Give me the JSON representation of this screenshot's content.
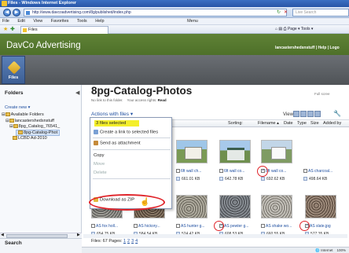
{
  "window": {
    "title": "Files - Windows Internet Explorer"
  },
  "browser": {
    "url": "http://www.davcoadvertising.com/8g/published/index.php",
    "search_placeholder": "Live Search",
    "menu": [
      "File",
      "Edit",
      "View",
      "Favorites",
      "Tools",
      "Help",
      "Menu"
    ],
    "tab_title": "Files",
    "toolset_label": "Page ▾  Tools ▾"
  },
  "app": {
    "brand": "DavCo Advertising",
    "user_links": "lancastershedsnstuff | Help | Logo",
    "files_button": "Files"
  },
  "sidebar": {
    "heading": "Folders",
    "create_new": "Create new ▾",
    "tree": [
      "Available Folders",
      "lancastershedsnstuff",
      "8pg_Catalog_76541_",
      "8pg-Catalog-Phot",
      "LCBD Ad-2010"
    ],
    "search_label": "Search"
  },
  "main": {
    "title": "8pg-Catalog-Photos",
    "no_link": "No link to this folder.",
    "access_label": "Your access rights:",
    "access_value": "Read",
    "full_screen": "Full scree",
    "actions_label": "Actions with files ▾",
    "view_label": "View:",
    "columns": {
      "sorting": "Sorting:",
      "filename": "Filename ▴",
      "date": "Date",
      "type": "Type",
      "size": "Size",
      "added_by": "Added by"
    },
    "files_footer_label": "Files: 67  Pages:",
    "pages": [
      "1",
      "2",
      "3",
      "4"
    ]
  },
  "dropdown": {
    "selected_count": "3 files selected",
    "items": [
      {
        "label": "Create a link to selected files",
        "enabled": true
      },
      {
        "label": "Send as attachment",
        "enabled": true
      },
      {
        "label": "Copy",
        "enabled": true
      },
      {
        "label": "Move",
        "enabled": false
      },
      {
        "label": "Delete",
        "enabled": false
      },
      {
        "label": "Download as ZIP",
        "enabled": true
      }
    ]
  },
  "files_row1": [
    {
      "name": "6ft wall ch...",
      "size": "661.01 KB",
      "checked": false
    },
    {
      "name": "6ft wall co...",
      "size": "642.78 KB",
      "checked": false
    },
    {
      "name": "8ft wall co...",
      "size": "692.62 KB",
      "checked": true
    },
    {
      "name": "AS charcoal...",
      "size": "498.64 KB",
      "checked": false
    }
  ],
  "files_row2": [
    {
      "name": "AS fox holl...",
      "size": "654.75 KB",
      "checked": false
    },
    {
      "name": "AS hickory...",
      "size": "584.54 KB",
      "checked": false
    },
    {
      "name": "AS hunter g...",
      "size": "524.42 KB",
      "checked": false
    },
    {
      "name": "AS pewter g...",
      "size": "608.53 KB",
      "checked": true
    },
    {
      "name": "AS shake wo...",
      "size": "660.55 KB",
      "checked": false
    },
    {
      "name": "AS slate.jpg",
      "size": "577.35 KB",
      "checked": true
    }
  ],
  "status": {
    "zone": "Internet",
    "zoom": "100%"
  },
  "colors": {
    "brand_green": "#5a7d33",
    "highlight_yellow": "#f4ef2a",
    "annotation_red": "#e0242a",
    "link_blue": "#1f4fa0"
  }
}
